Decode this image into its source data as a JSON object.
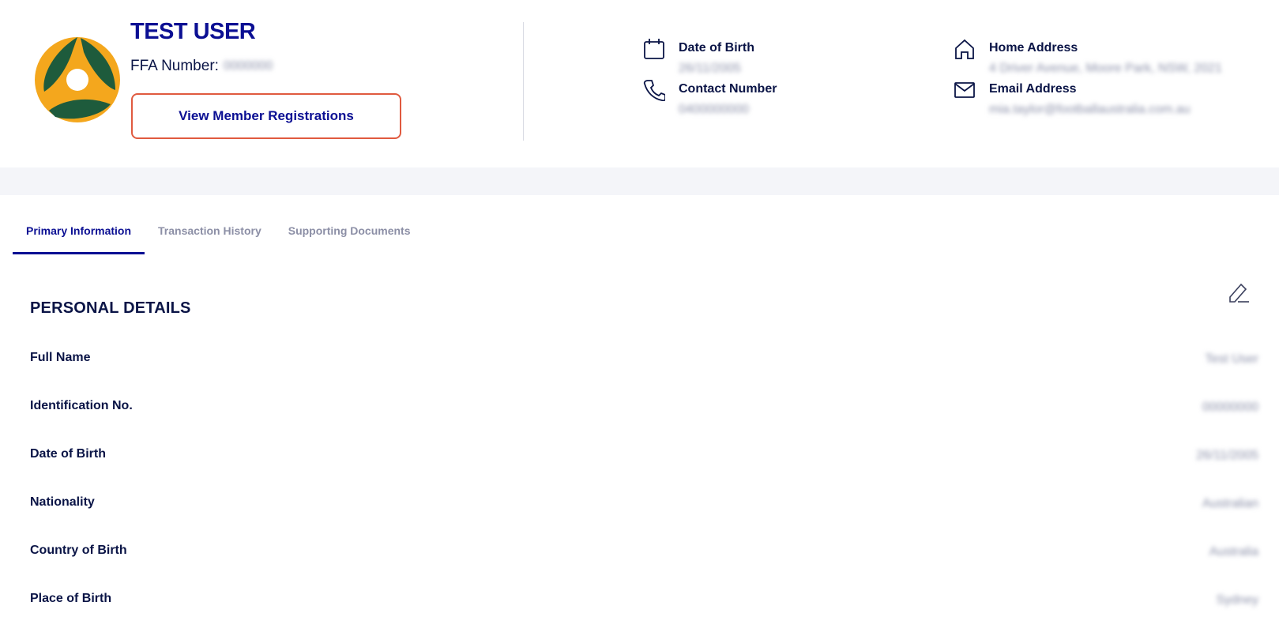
{
  "profile": {
    "name": "TEST USER",
    "ffa_label": "FFA Number:",
    "ffa_value": "0000000",
    "view_registrations_label": "View Member Registrations"
  },
  "contact": {
    "dob_label": "Date of Birth",
    "dob_value": "26/11/2005",
    "phone_label": "Contact Number",
    "phone_value": "0400000000",
    "address_label": "Home Address",
    "address_value": "4 Driver Avenue, Moore Park, NSW, 2021",
    "email_label": "Email Address",
    "email_value": "mia.taylor@footballaustralia.com.au"
  },
  "tabs": [
    {
      "label": "Primary Information",
      "active": true
    },
    {
      "label": "Transaction History",
      "active": false
    },
    {
      "label": "Supporting Documents",
      "active": false
    }
  ],
  "personal": {
    "title": "PERSONAL DETAILS",
    "rows": [
      {
        "label": "Full Name",
        "value": "Test User"
      },
      {
        "label": "Identification No.",
        "value": "00000000"
      },
      {
        "label": "Date of Birth",
        "value": "26/11/2005"
      },
      {
        "label": "Nationality",
        "value": "Australian"
      },
      {
        "label": "Country of Birth",
        "value": "Australia"
      },
      {
        "label": "Place of Birth",
        "value": "Sydney"
      }
    ]
  },
  "colors": {
    "brand_navy": "#0b0f93",
    "text_dark": "#0a1446",
    "highlight_border": "#e05a3f",
    "logo_green": "#1e5b3c",
    "logo_gold": "#f4a71d"
  },
  "icons": {
    "logo": "football-australia-logo",
    "dob": "calendar-icon",
    "phone": "phone-icon",
    "address": "home-icon",
    "email": "mail-icon",
    "edit": "pencil-edit-icon"
  }
}
